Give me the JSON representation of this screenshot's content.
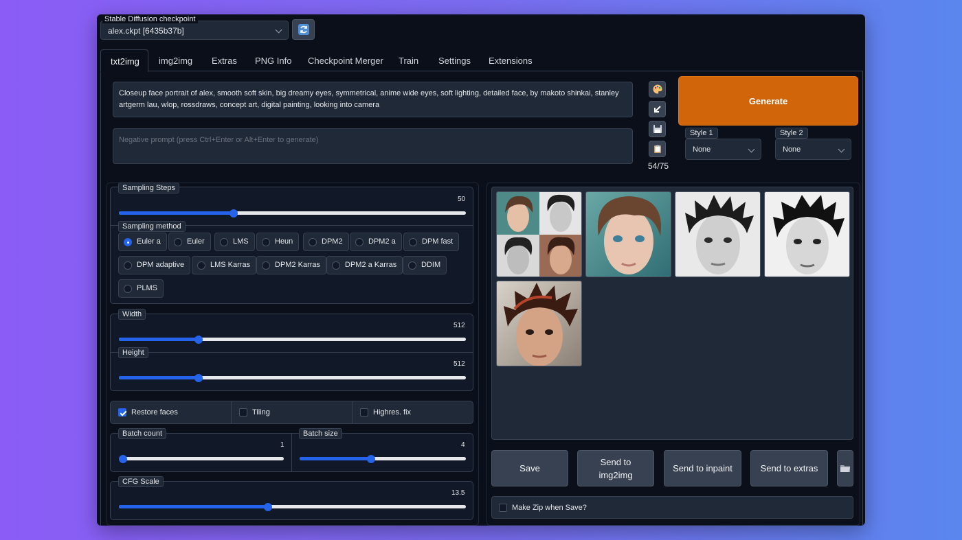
{
  "checkpoint": {
    "label": "Stable Diffusion checkpoint",
    "value": "alex.ckpt [6435b37b]",
    "refresh_icon": "refresh-icon"
  },
  "tabs": [
    {
      "label": "txt2img",
      "active": true
    },
    {
      "label": "img2img"
    },
    {
      "label": "Extras"
    },
    {
      "label": "PNG Info"
    },
    {
      "label": "Checkpoint Merger"
    },
    {
      "label": "Train"
    },
    {
      "label": "Settings"
    },
    {
      "label": "Extensions"
    }
  ],
  "prompt": {
    "value": "Closeup face portrait of  alex, smooth soft skin, big dreamy eyes, symmetrical, anime wide eyes, soft lighting, detailed face, by makoto shinkai, stanley artgerm lau, wlop, rossdraws, concept art, digital painting, looking into camera",
    "negative_placeholder": "Negative prompt (press Ctrl+Enter or Alt+Enter to generate)",
    "token_count": "54/75"
  },
  "tools": [
    "palette-icon",
    "arrow-icon",
    "save-icon",
    "clipboard-icon"
  ],
  "generate_label": "Generate",
  "styles": {
    "style1_label": "Style 1",
    "style1_value": "None",
    "style2_label": "Style 2",
    "style2_value": "None"
  },
  "sampling_steps": {
    "label": "Sampling Steps",
    "value": "50",
    "fraction": 0.33
  },
  "sampling_method": {
    "label": "Sampling method",
    "selected": "Euler a",
    "options": [
      "Euler a",
      "Euler",
      "LMS",
      "Heun",
      "DPM2",
      "DPM2 a",
      "DPM fast",
      "DPM adaptive",
      "LMS Karras",
      "DPM2 Karras",
      "DPM2 a Karras",
      "DDIM",
      "PLMS"
    ]
  },
  "width": {
    "label": "Width",
    "value": "512",
    "fraction": 0.23
  },
  "height": {
    "label": "Height",
    "value": "512",
    "fraction": 0.23
  },
  "checks": {
    "restore_faces": {
      "label": "Restore faces",
      "checked": true
    },
    "tiling": {
      "label": "Tiling",
      "checked": false
    },
    "highres": {
      "label": "Highres. fix",
      "checked": false
    }
  },
  "batch_count": {
    "label": "Batch count",
    "value": "1",
    "fraction": 0.0
  },
  "batch_size": {
    "label": "Batch size",
    "value": "4",
    "fraction": 0.43
  },
  "cfg_scale": {
    "label": "CFG Scale",
    "value": "13.5",
    "fraction": 0.43
  },
  "actions": {
    "save": "Save",
    "send_img2img_line1": "Send to",
    "send_img2img_line2": "img2img",
    "send_inpaint": "Send to inpaint",
    "send_extras": "Send to extras",
    "folder_icon": "folder-icon"
  },
  "make_zip_label": "Make Zip when Save?"
}
